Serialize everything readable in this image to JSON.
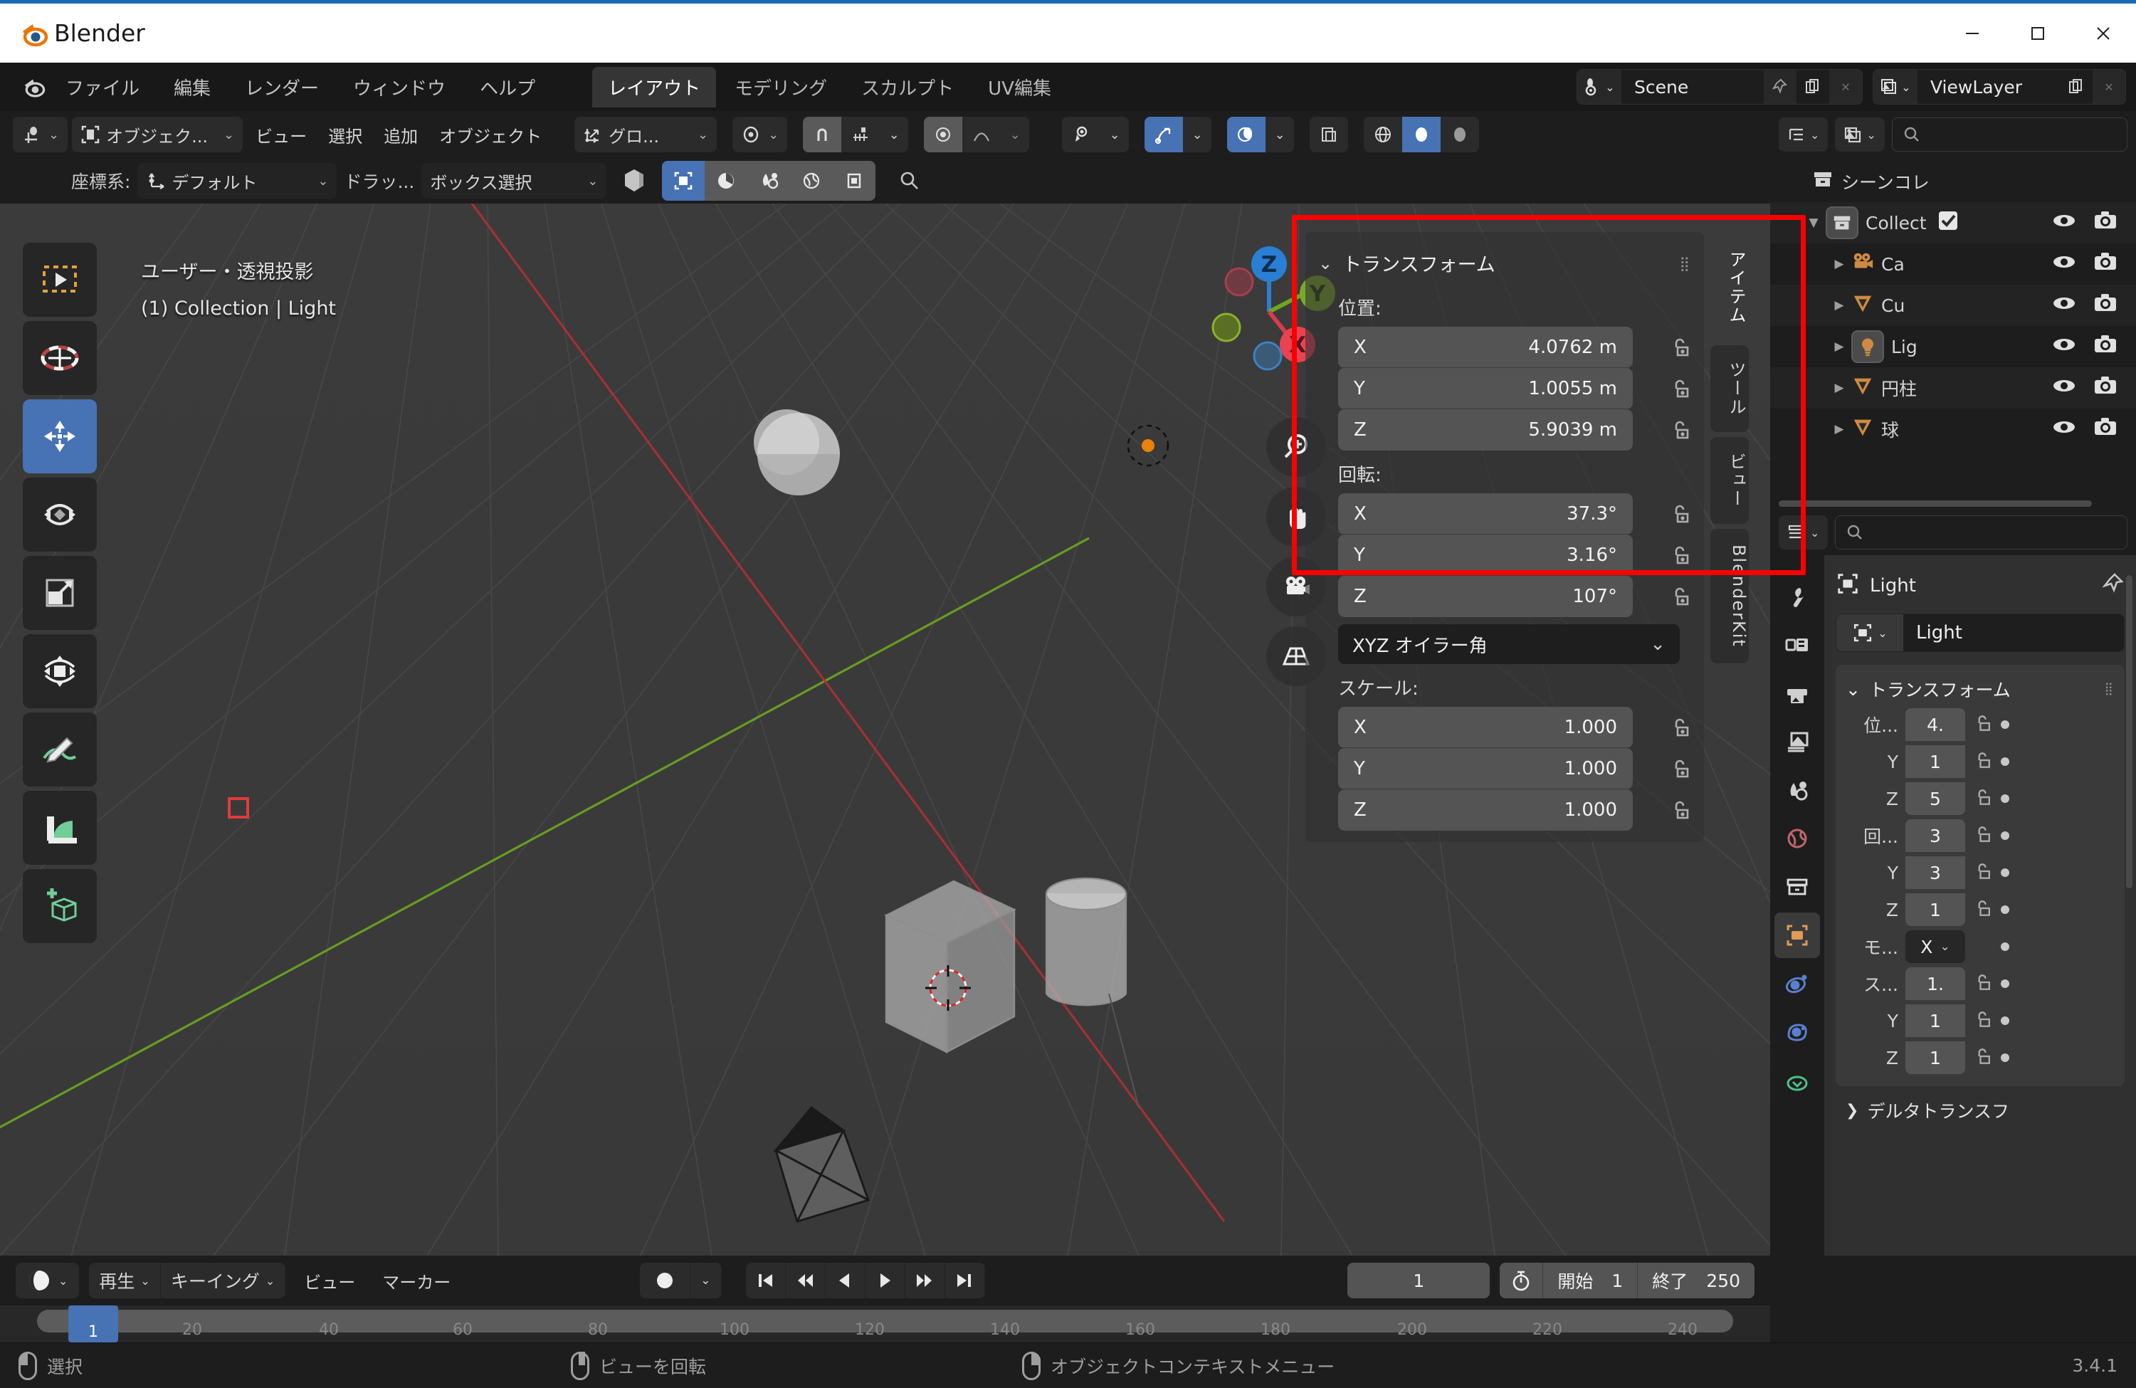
{
  "window": {
    "title": "Blender",
    "minimize": "─",
    "maximize": "☐",
    "close": "✕"
  },
  "topbar": {
    "menus": [
      "ファイル",
      "編集",
      "レンダー",
      "ウィンドウ",
      "ヘルプ"
    ],
    "workspace_tabs": [
      {
        "label": "レイアウト",
        "active": true
      },
      {
        "label": "モデリング",
        "active": false
      },
      {
        "label": "スカルプト",
        "active": false
      },
      {
        "label": "UV編集",
        "active": false
      }
    ],
    "scene": {
      "name": "Scene",
      "icon": "scene-icon",
      "new_icon": "copy-icon",
      "close_icon": "x-icon"
    },
    "viewlayer": {
      "name": "ViewLayer",
      "icon": "viewlayer-icon",
      "new_icon": "copy-icon",
      "close_icon": "x-icon"
    }
  },
  "viewport_header": {
    "editor_type_icon": "editor-type-icon",
    "mode": "オブジェク...",
    "menus": [
      "ビュー",
      "選択",
      "追加",
      "オブジェクト"
    ],
    "transform_orientation": "グロ...",
    "pivot_icon": "pivot-icon",
    "snap_icon": "snap-magnet-icon",
    "proportional_icon": "proportional-edit-icon",
    "visibility_icon": "eye-icon",
    "gizmo_icon": "gizmo-icon",
    "overlay_icon": "overlays-icon",
    "xray_icon": "xray-icon",
    "shading": [
      "wireframe",
      "solid",
      "material-preview",
      "rendered"
    ]
  },
  "viewport_header2": {
    "orientation_label": "座標系:",
    "orientation_value": "デフォルト",
    "drag_label": "ドラッ...",
    "drag_value": "ボックス選択",
    "snap_hex_icon": "snap-hex-icon",
    "mode_icons": [
      "select-box-icon",
      "pie-icon",
      "droplet-icon",
      "globe-icon",
      "magnet-icon"
    ],
    "search_icon": "search-icon"
  },
  "viewport_overlay": {
    "line1": "ユーザー・透視投影",
    "line2": "(1) Collection | Light"
  },
  "toolbar_tools": [
    {
      "name": "tweak-tool",
      "icon": "cursor-select-icon",
      "active": false
    },
    {
      "name": "cursor-tool",
      "icon": "3d-cursor-icon",
      "active": false
    },
    {
      "name": "move-tool",
      "icon": "move-arrows-icon",
      "active": true
    },
    {
      "name": "rotate-tool",
      "icon": "rotate-icon",
      "active": false
    },
    {
      "name": "scale-tool",
      "icon": "scale-icon",
      "active": false
    },
    {
      "name": "transform-tool",
      "icon": "transform-icon",
      "active": false
    },
    {
      "name": "annotate-tool",
      "icon": "pencil-icon",
      "active": false
    },
    {
      "name": "measure-tool",
      "icon": "ruler-icon",
      "active": false
    },
    {
      "name": "add-cube-tool",
      "icon": "add-cube-icon",
      "active": false
    }
  ],
  "nav_gizmo": {
    "x": "X",
    "y": "Y",
    "z": "Z"
  },
  "nav_buttons": [
    {
      "name": "zoom-button",
      "icon": "magnifier-plus-icon"
    },
    {
      "name": "pan-button",
      "icon": "hand-icon"
    },
    {
      "name": "camera-view-button",
      "icon": "camera-icon"
    },
    {
      "name": "toggle-perspective-button",
      "icon": "grid-perspective-icon"
    }
  ],
  "side_tabs": [
    {
      "label": "アイテム",
      "active": true
    },
    {
      "label": "ツール",
      "active": false
    },
    {
      "label": "ビュー",
      "active": false
    },
    {
      "label": "BlenderKit",
      "active": false
    }
  ],
  "transform_panel": {
    "title": "トランスフォーム",
    "location_label": "位置:",
    "location": [
      {
        "axis": "X",
        "value": "4.0762 m"
      },
      {
        "axis": "Y",
        "value": "1.0055 m"
      },
      {
        "axis": "Z",
        "value": "5.9039 m"
      }
    ],
    "rotation_label": "回転:",
    "rotation": [
      {
        "axis": "X",
        "value": "37.3°"
      },
      {
        "axis": "Y",
        "value": "3.16°"
      },
      {
        "axis": "Z",
        "value": "107°"
      }
    ],
    "rotation_mode": "XYZ オイラー角",
    "scale_label": "スケール:",
    "scale": [
      {
        "axis": "X",
        "value": "1.000"
      },
      {
        "axis": "Y",
        "value": "1.000"
      },
      {
        "axis": "Z",
        "value": "1.000"
      }
    ]
  },
  "annotation": {
    "color": "#fa0000"
  },
  "outliner": {
    "filter_placeholder": "",
    "rows": [
      {
        "name": "シーンコレ",
        "indent": 0,
        "icon": "collection-box-icon",
        "expander": "",
        "has_checkbox": false,
        "highlight": false
      },
      {
        "name": "Collect",
        "indent": 1,
        "icon": "collection-box-icon",
        "expander": "▼",
        "has_checkbox": true,
        "highlight": true
      },
      {
        "name": "Ca",
        "indent": 2,
        "icon": "camera-object-icon",
        "expander": "▶",
        "has_checkbox": false,
        "highlight": false
      },
      {
        "name": "Cu",
        "indent": 2,
        "icon": "mesh-object-icon",
        "expander": "▶",
        "has_checkbox": false,
        "highlight": false
      },
      {
        "name": "Lig",
        "indent": 2,
        "icon": "light-object-icon",
        "expander": "▶",
        "has_checkbox": false,
        "highlight": true
      },
      {
        "name": "円柱",
        "indent": 2,
        "icon": "mesh-object-icon",
        "expander": "▶",
        "has_checkbox": false,
        "highlight": false
      },
      {
        "name": "球",
        "indent": 2,
        "icon": "mesh-object-icon",
        "expander": "▶",
        "has_checkbox": false,
        "highlight": false
      }
    ]
  },
  "properties": {
    "breadcrumb_icon": "object-icon",
    "breadcrumb": "Light",
    "pin_icon": "pin-icon",
    "datablock_name": "Light",
    "panel_title": "トランスフォーム",
    "tabs": [
      {
        "name": "tool-tab",
        "icon": "wrench-icon",
        "active": false
      },
      {
        "name": "render-tab",
        "icon": "render-camera-icon",
        "active": false
      },
      {
        "name": "output-tab",
        "icon": "printer-icon",
        "active": false
      },
      {
        "name": "viewlayer-tab",
        "icon": "images-icon",
        "active": false
      },
      {
        "name": "scene-tab",
        "icon": "scene-cone-icon",
        "active": false
      },
      {
        "name": "world-tab",
        "icon": "world-globe-icon",
        "active": false
      },
      {
        "name": "collection-tab",
        "icon": "collection-box-icon",
        "active": false
      },
      {
        "name": "object-tab",
        "icon": "object-square-icon",
        "active": true
      },
      {
        "name": "modifier-tab",
        "icon": "physics-orbit-icon",
        "active": false
      },
      {
        "name": "constraints-tab",
        "icon": "constraint-icon",
        "active": false
      },
      {
        "name": "data-tab",
        "icon": "data-green-icon",
        "active": false
      }
    ],
    "rows": [
      {
        "label": "位...",
        "value": "4.",
        "type": "field",
        "pos": "top"
      },
      {
        "label": "Y",
        "value": "1",
        "type": "field",
        "pos": "mid"
      },
      {
        "label": "Z",
        "value": "5",
        "type": "field",
        "pos": "bot"
      },
      {
        "label": "回...",
        "value": "3",
        "type": "field",
        "pos": "top"
      },
      {
        "label": "Y",
        "value": "3",
        "type": "field",
        "pos": "mid"
      },
      {
        "label": "Z",
        "value": "1",
        "type": "field",
        "pos": "bot"
      },
      {
        "label": "モ...",
        "value": "X",
        "type": "dropdown",
        "pos": "solo"
      },
      {
        "label": "ス...",
        "value": "1.",
        "type": "field",
        "pos": "top"
      },
      {
        "label": "Y",
        "value": "1",
        "type": "field",
        "pos": "mid"
      },
      {
        "label": "Z",
        "value": "1",
        "type": "field",
        "pos": "bot"
      }
    ],
    "delta_transform": "デルタトランスフ"
  },
  "timeline": {
    "editor_icon": "timeline-editor-icon",
    "menus": [
      "再生",
      "キーイング",
      "ビュー",
      "マーカー"
    ],
    "record_icon": "record-circle-icon",
    "playback_buttons": [
      "jump-start-icon",
      "prev-keyframe-icon",
      "play-reverse-icon",
      "play-icon",
      "next-keyframe-icon",
      "jump-end-icon"
    ],
    "current_frame": "1",
    "timer_icon": "stopwatch-icon",
    "start_label": "開始",
    "start_value": "1",
    "end_label": "終了",
    "end_value": "250",
    "ruler_ticks": [
      "20",
      "40",
      "60",
      "80",
      "100",
      "120",
      "140",
      "160",
      "180",
      "200",
      "220",
      "240"
    ],
    "playhead_label": "1"
  },
  "statusbar": {
    "items": [
      {
        "mouse": "left",
        "label": "選択"
      },
      {
        "mouse": "middle",
        "label": "ビューを回転"
      },
      {
        "mouse": "right",
        "label": "オブジェクトコンテキストメニュー"
      }
    ],
    "version": "3.4.1"
  }
}
